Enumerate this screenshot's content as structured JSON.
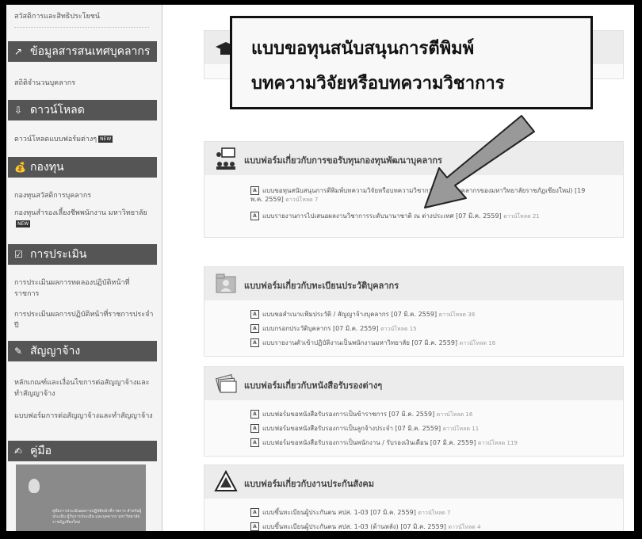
{
  "sidebar": {
    "top_link": "สวัสดิการและสิทธิประโยชน์",
    "sections": [
      {
        "icon": "chart-icon",
        "title": "ข้อมูลสารสนเทศบุคลากร",
        "links": [
          {
            "label": "สถิติจำนวนบุคลากร",
            "badge": ""
          }
        ]
      },
      {
        "icon": "download-icon",
        "title": "ดาวน์โหลด",
        "links": [
          {
            "label": "ดาวน์โหลดแบบฟอร์มต่างๆ",
            "badge": "NEW"
          }
        ]
      },
      {
        "icon": "money-bag-icon",
        "title": "กองทุน",
        "links": [
          {
            "label": "กองทุนสวัสดิการบุคลากร",
            "badge": ""
          },
          {
            "label": "กองทุนสำรองเลี้ยงชีพพนักงาน มหาวิทยาลัย",
            "badge": "NEW"
          }
        ]
      },
      {
        "icon": "checkbox-icon",
        "title": "การประเมิน",
        "links": [
          {
            "label": "การประเมินผลการทดลองปฏิบัติหน้าที่ราชการ",
            "badge": ""
          },
          {
            "label": "การประเมินผลการปฏิบัติหน้าที่ราชการประจำปี",
            "badge": ""
          }
        ]
      },
      {
        "icon": "contract-icon",
        "title": "สัญญาจ้าง",
        "links": [
          {
            "label": "หลักเกณฑ์และเงื่อนไขการต่อสัญญาจ้างและทำสัญญาจ้าง",
            "badge": ""
          },
          {
            "label": "แบบฟอร์มการต่อสัญญาจ้างและทำสัญญาจ้าง",
            "badge": ""
          }
        ]
      },
      {
        "icon": "book-icon",
        "title": "คู่มือ",
        "links": []
      }
    ],
    "promo_text": "คู่มือการประเมินผลการปฏิบัติหน้าที่ราชการ สำหรับผู้ประเมิน ผู้รับการประเมิน และบุคลากร มหาวิทยาลัยราชภัฏเชียงใหม่"
  },
  "callout": {
    "line1": "แบบขอทุนสนับสนุนการตีพิมพ์",
    "line2": "บทความวิจัยหรือบทความวิชาการ"
  },
  "main": {
    "blocks": [
      {
        "icon": "meeting-icon",
        "title": "แบบฟอร์มเกี่ยวกับการขอรับทุนกองทุนพัฒนาบุคลากร",
        "files": [
          {
            "text": "แบบขอทุนสนับสนุนการตีพิมพ์บทความวิจัยหรือบทความวิชาการ(สำหรับบุคลากรของมหาวิทยาลัยราชภัฏเชียงใหม่) [19 พ.ค. 2559]",
            "count": "ดาวน์โหลด 7"
          },
          {
            "text": "แบบรายงานการไปเสนอผลงานวิชาการระดับนานาชาติ ณ ต่างประเทศ [07 มิ.ค. 2559]",
            "count": "ดาวน์โหลด 21"
          }
        ]
      },
      {
        "icon": "person-folder-icon",
        "title": "แบบฟอร์มเกี่ยวกับทะเบียนประวัติบุคลากร",
        "files": [
          {
            "text": "แบบขอสำเนาแฟ้มประวัติ / สัญญาจ้างบุคลากร [07 มิ.ค. 2559]",
            "count": "ดาวน์โหลด 38"
          },
          {
            "text": "แบบกรอกประวัติบุคลากร [07 มิ.ค. 2559]",
            "count": "ดาวน์โหลด 15"
          },
          {
            "text": "แบบรายงานตัวเข้าปฏิบัติงานเป็นพนักงานมหาวิทยาลัย [07 มิ.ค. 2559]",
            "count": "ดาวน์โหลด 16"
          }
        ]
      },
      {
        "icon": "certificates-icon",
        "title": "แบบฟอร์มเกี่ยวกับหนังสือรับรองต่างๆ",
        "files": [
          {
            "text": "แบบฟอร์มขอหนังสือรับรองการเป็นข้าราชการ [07 มิ.ค. 2559]",
            "count": "ดาวน์โหลด 16"
          },
          {
            "text": "แบบฟอร์มขอหนังสือรับรองการเป็นลูกจ้างประจำ [07 มิ.ค. 2559]",
            "count": "ดาวน์โหลด 11"
          },
          {
            "text": "แบบฟอร์มขอหนังสือรับรองการเป็นพนักงาน / รับรองเงินเดือน [07 มิ.ค. 2559]",
            "count": "ดาวน์โหลด 119"
          }
        ]
      },
      {
        "icon": "social-security-icon",
        "title": "แบบฟอร์มเกี่ยวกับงานประกันสังคม",
        "files": [
          {
            "text": "แบบขึ้นทะเบียนผู้ประกันตน สปส. 1-03 [07 มิ.ค. 2559]",
            "count": "ดาวน์โหลด 7"
          },
          {
            "text": "แบบขึ้นทะเบียนผู้ประกันตน สปส. 1-03 (ด้านหลัง) [07 มิ.ค. 2559]",
            "count": "ดาวน์โหลด 4"
          }
        ]
      }
    ]
  }
}
